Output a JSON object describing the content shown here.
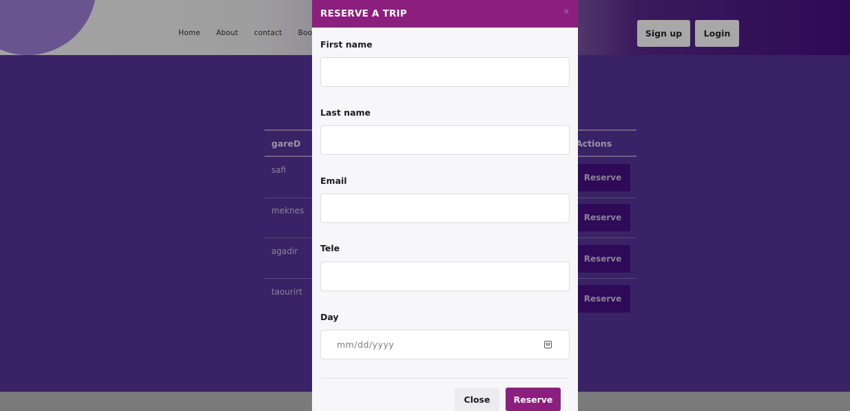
{
  "nav": {
    "links": [
      "Home",
      "About",
      "contact",
      "Book"
    ],
    "signup_label": "Sign up",
    "login_label": "Login"
  },
  "table": {
    "headers": {
      "station": "gareD",
      "actions": "Actions"
    },
    "rows": [
      {
        "station": "safi",
        "action_label": "Reserve"
      },
      {
        "station": "meknes",
        "action_label": "Reserve"
      },
      {
        "station": "agadir",
        "action_label": "Reserve"
      },
      {
        "station": "taourirt",
        "action_label": "Reserve"
      }
    ]
  },
  "modal": {
    "title": "RESERVE A TRIP",
    "close_icon": "×",
    "fields": {
      "first_name": {
        "label": "First name",
        "value": ""
      },
      "last_name": {
        "label": "Last name",
        "value": ""
      },
      "email": {
        "label": "Email",
        "value": ""
      },
      "tele": {
        "label": "Tele",
        "value": ""
      },
      "day": {
        "label": "Day",
        "placeholder": "mm/dd/yyyy"
      }
    },
    "close_button": "Close",
    "reserve_button": "Reserve"
  },
  "colors": {
    "modal_accent": "#8c1f7e",
    "content_bg": "#3a2266",
    "row_button_bg": "#2e0a58"
  }
}
